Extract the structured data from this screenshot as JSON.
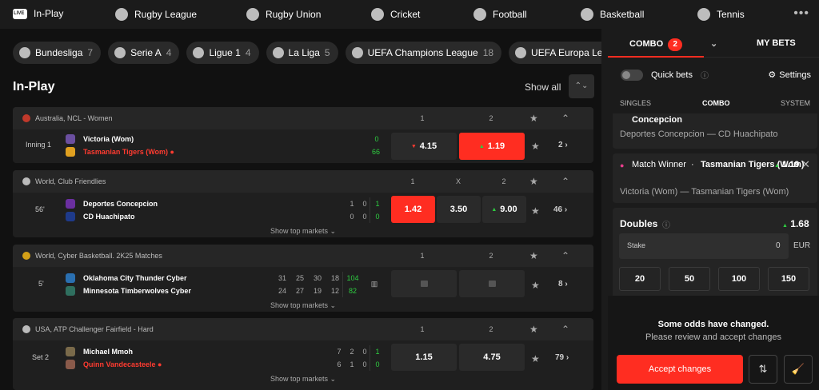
{
  "nav": {
    "items": [
      {
        "label": "In-Play",
        "icon": "live-icon"
      },
      {
        "label": "Rugby League",
        "icon": "rugby-ball-icon"
      },
      {
        "label": "Rugby Union",
        "icon": "rugby-ball-icon"
      },
      {
        "label": "Cricket",
        "icon": "cricket-ball-icon"
      },
      {
        "label": "Football",
        "icon": "football-icon"
      },
      {
        "label": "Basketball",
        "icon": "basketball-icon"
      },
      {
        "label": "Tennis",
        "icon": "tennis-ball-icon"
      }
    ],
    "more": "•••"
  },
  "chips": [
    {
      "label": "Bundesliga",
      "count": "7"
    },
    {
      "label": "Serie A",
      "count": "4"
    },
    {
      "label": "Ligue 1",
      "count": "4"
    },
    {
      "label": "La Liga",
      "count": "5"
    },
    {
      "label": "UEFA Champions League",
      "count": "18"
    },
    {
      "label": "UEFA Europa League",
      "count": "18"
    }
  ],
  "section": {
    "title": "In-Play",
    "show_all": "Show all",
    "collapse": "⌃⌄"
  },
  "events": [
    {
      "league": "Australia, NCL - Women",
      "cols": [
        "1",
        "2"
      ],
      "period": "Inning 1",
      "team1": "Victoria (Wom)",
      "team2": "Tasmanian Tigers (Wom)",
      "score1": "0",
      "score2": "66",
      "odds": [
        "4.15",
        "1.19"
      ],
      "more": "2"
    },
    {
      "league": "World, Club Friendlies",
      "cols": [
        "1",
        "X",
        "2"
      ],
      "period": "56'",
      "team1": "Deportes Concepcion",
      "team2": "CD Huachipato",
      "s1": [
        "1",
        "0",
        "1"
      ],
      "s2": [
        "0",
        "0",
        "0"
      ],
      "odds": [
        "1.42",
        "3.50",
        "9.00"
      ],
      "more": "46",
      "show_top": "Show top markets"
    },
    {
      "league": "World, Cyber Basketball. 2K25 Matches",
      "cols": [
        "1",
        "2"
      ],
      "period": "5'",
      "team1": "Oklahoma City Thunder Cyber",
      "team2": "Minnesota Timberwolves Cyber",
      "s1": [
        "31",
        "25",
        "30",
        "18",
        "104"
      ],
      "s2": [
        "24",
        "27",
        "19",
        "12",
        "82"
      ],
      "more": "8",
      "show_top": "Show top markets"
    },
    {
      "league": "USA, ATP Challenger Fairfield - Hard",
      "cols": [
        "1",
        "2"
      ],
      "period": "Set 2",
      "team1": "Michael Mmoh",
      "team2": "Quinn Vandecasteele",
      "s1": [
        "7",
        "2",
        "0",
        "1"
      ],
      "s2": [
        "6",
        "1",
        "0",
        "0"
      ],
      "odds": [
        "1.15",
        "4.75"
      ],
      "more": "79",
      "show_top": "Show top markets"
    }
  ],
  "betslip": {
    "combo_label": "COMBO",
    "combo_count": "2",
    "my_bets": "MY BETS",
    "quick_bets": "Quick bets",
    "settings": "Settings",
    "subtabs": [
      "SINGLES",
      "COMBO",
      "SYSTEM"
    ],
    "bet1": {
      "team": "Concepcion",
      "match": "Deportes Concepcion — CD Huachipato"
    },
    "bet2": {
      "market": "Match Winner",
      "sep": "·",
      "team": "Tasmanian Tigers (Wom)",
      "odd": "1.19",
      "match": "Victoria (Wom) — Tasmanian Tigers (Wom)"
    },
    "doubles": {
      "label": "Doubles",
      "odd": "1.68",
      "stake_label": "Stake",
      "stake_value": "0",
      "currency": "EUR",
      "amounts": [
        "20",
        "50",
        "100",
        "150"
      ]
    },
    "notice_title": "Some odds have changed.",
    "notice_sub": "Please review and accept changes",
    "accept": "Accept changes"
  },
  "colors": {
    "accent": "#ff2d21",
    "positive": "#2ecc40"
  }
}
